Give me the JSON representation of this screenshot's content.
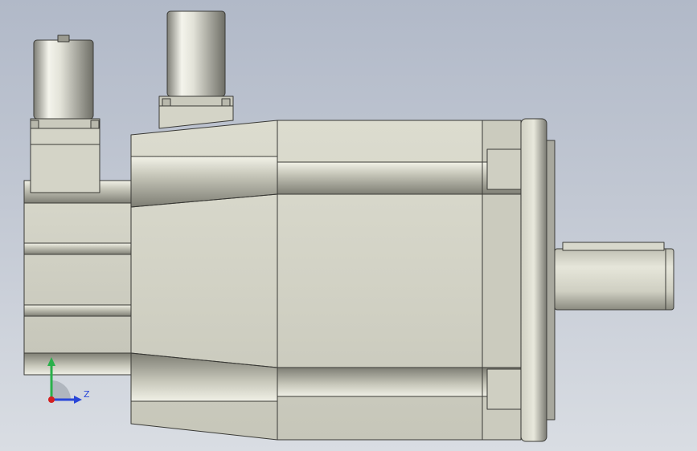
{
  "app": {
    "name": "",
    "view": "Front"
  },
  "viewport": {
    "background_top": "#b1b9c8",
    "background_bottom": "#d9dde3",
    "model": "servo-motor-side-view"
  },
  "colors": {
    "body_light": "#e4e4d7",
    "body_mid": "#cfcfc2",
    "body_dark": "#8e8e84",
    "edge": "#3a3a36"
  },
  "triad": {
    "z_label": "Z",
    "y_color": "#29b04a",
    "z_color": "#2946d8",
    "origin_color": "#d42020"
  }
}
